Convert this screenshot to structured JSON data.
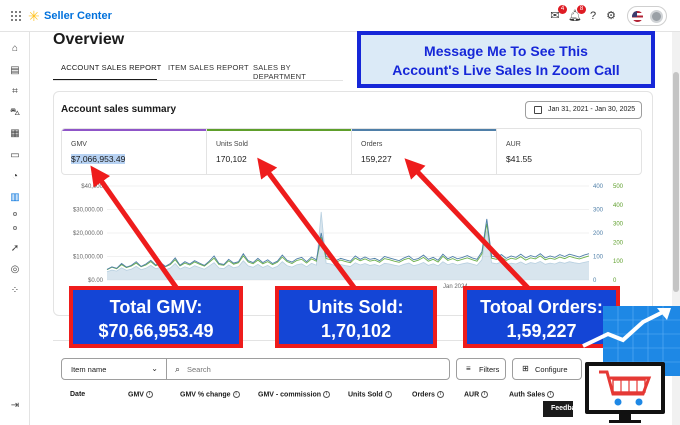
{
  "app": {
    "brand": "Seller Center"
  },
  "topbar": {
    "notifications": [
      {
        "icon": "mail-icon",
        "count": "4"
      },
      {
        "icon": "bell-icon",
        "count": "8"
      }
    ]
  },
  "page": {
    "title": "Overview",
    "tabs": [
      {
        "label": "ACCOUNT SALES REPORT",
        "active": true
      },
      {
        "label": "ITEM SALES REPORT",
        "active": false
      },
      {
        "label": "SALES BY DEPARTMENT",
        "active": false
      }
    ]
  },
  "summary": {
    "title": "Account sales summary",
    "date_range": "Jan 31, 2021 - Jan 30, 2025",
    "metrics": [
      {
        "label": "GMV",
        "value": "$7,066,953.49",
        "color": "#8f55c8"
      },
      {
        "label": "Units Sold",
        "value": "170,102",
        "color": "#5e9f2b"
      },
      {
        "label": "Orders",
        "value": "159,227",
        "color": "#4f7fa8"
      },
      {
        "label": "AUR",
        "value": "$41.55",
        "color": "#9e9e9e"
      }
    ]
  },
  "chart_data": {
    "type": "line",
    "y_left_ticks": [
      "$40,000",
      "$30,000.00",
      "$20,000.00",
      "$10,000.00",
      "$0.00"
    ],
    "y_right1_ticks": [
      "400",
      "300",
      "200",
      "100",
      "0"
    ],
    "y_right2_ticks": [
      "500",
      "400",
      "300",
      "200",
      "100",
      "0"
    ],
    "x_tick_labels": [
      "Jan 2024"
    ],
    "y_left_range": [
      0,
      40000
    ],
    "y_right1_range": [
      0,
      400
    ],
    "y_right2_range": [
      0,
      500
    ],
    "series": [
      {
        "color": "#b8d0e0",
        "values": [
          3500,
          4200,
          3800,
          5200,
          4100,
          4600,
          5800,
          4400,
          5000,
          6200,
          4800,
          5400,
          4300,
          5100,
          7000,
          4700,
          5600,
          4900,
          6100,
          5300,
          4600,
          5900,
          7400,
          5100,
          4800,
          6400,
          5200,
          5700,
          8200,
          6000,
          5400,
          6700,
          5300,
          6200,
          5000,
          5800,
          7800,
          6100,
          5500,
          6500,
          6900,
          5600,
          7100,
          6300,
          29000,
          7200,
          6800,
          5900,
          6600,
          6100,
          5800,
          7300,
          6400,
          7000,
          6200,
          6600,
          5900,
          7100,
          6800,
          6300,
          5900,
          6700,
          7200,
          6100,
          6600,
          7500,
          6200,
          6900,
          6000,
          7800,
          6500,
          7100,
          6400,
          6900,
          7300,
          6800,
          6200,
          8600,
          21000,
          7300,
          6900,
          7600,
          6500,
          7200,
          6800,
          7700,
          6600,
          7400,
          7000,
          7900,
          6700,
          7200,
          6800,
          7600,
          7100,
          7800,
          7300,
          7000,
          7500,
          7900
        ]
      },
      {
        "color": "#6bb04c",
        "values": [
          55,
          68,
          60,
          82,
          66,
          74,
          90,
          70,
          80,
          98,
          76,
          86,
          70,
          82,
          108,
          75,
          90,
          80,
          96,
          84,
          74,
          94,
          116,
          82,
          78,
          102,
          84,
          92,
          128,
          96,
          86,
          106,
          86,
          98,
          82,
          94,
          122,
          98,
          88,
          104,
          110,
          90,
          112,
          100,
          230,
          114,
          108,
          94,
          106,
          98,
          92,
          116,
          102,
          112,
          100,
          106,
          94,
          114,
          108,
          100,
          94,
          108,
          116,
          98,
          106,
          120,
          100,
          110,
          96,
          126,
          104,
          114,
          102,
          110,
          118,
          108,
          100,
          138,
          300,
          116,
          110,
          122,
          104,
          116,
          110,
          124,
          106,
          118,
          112,
          128,
          108,
          116,
          110,
          122,
          114,
          126,
          118,
          112,
          120,
          128
        ]
      },
      {
        "color": "#4f7fa8",
        "values": [
          45,
          56,
          50,
          70,
          55,
          62,
          78,
          58,
          68,
          84,
          64,
          74,
          58,
          70,
          94,
          63,
          78,
          68,
          82,
          72,
          62,
          80,
          102,
          70,
          66,
          88,
          72,
          78,
          112,
          82,
          74,
          92,
          74,
          86,
          70,
          80,
          106,
          84,
          76,
          90,
          96,
          78,
          98,
          86,
          200,
          100,
          94,
          82,
          92,
          86,
          80,
          102,
          88,
          98,
          88,
          92,
          82,
          100,
          94,
          88,
          82,
          94,
          102,
          86,
          92,
          106,
          88,
          96,
          84,
          110,
          90,
          100,
          90,
          96,
          104,
          94,
          88,
          120,
          260,
          102,
          96,
          108,
          92,
          102,
          96,
          110,
          94,
          104,
          98,
          112,
          94,
          102,
          96,
          108,
          100,
          110,
          104,
          98,
          106,
          112
        ]
      }
    ]
  },
  "annotations": {
    "message": [
      "Message Me To See This",
      "Account's Live Sales In Zoom Call"
    ],
    "callouts": [
      {
        "line1": "Total GMV:",
        "line2": "$70,66,953.49"
      },
      {
        "line1": "Units Sold:",
        "line2": "1,70,102"
      },
      {
        "line1": "Totoal Orders:",
        "line2": "1,59,227"
      }
    ]
  },
  "table": {
    "select_value": "Item name",
    "search_placeholder": "Search",
    "filters_label": "Filters",
    "configure_label": "Configure",
    "columns": [
      "Date",
      "GMV",
      "GMV % change",
      "GMV - commission",
      "Units Sold",
      "Orders",
      "AUR",
      "Auth Sales"
    ],
    "feedback_label": "Feedback"
  }
}
